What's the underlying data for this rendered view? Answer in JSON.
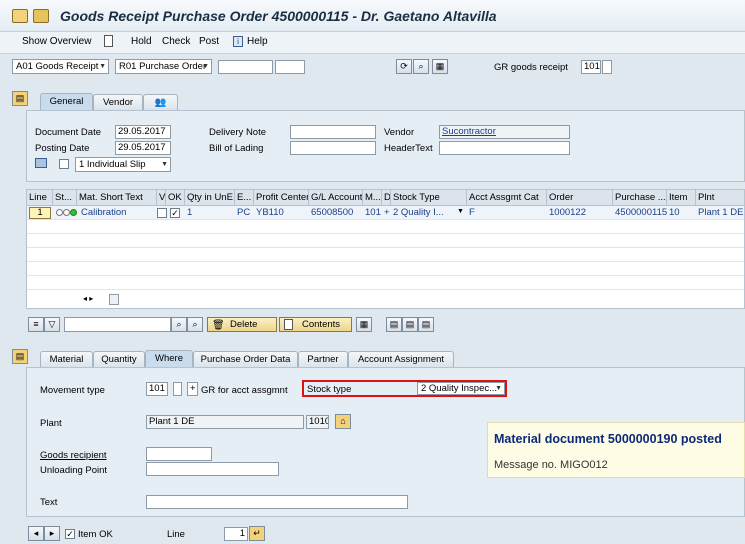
{
  "window": {
    "title": "Goods Receipt Purchase Order 4500000115 - Dr. Gaetano Altavilla"
  },
  "toolbar": {
    "show_overview": "Show Overview",
    "hold": "Hold",
    "check": "Check",
    "post": "Post",
    "help": "Help"
  },
  "header_bar": {
    "action": "A01 Goods Receipt",
    "reference": "R01 Purchase Order",
    "gr_label": "GR goods receipt",
    "movement_code": "101"
  },
  "header_tabs": [
    "General",
    "Vendor"
  ],
  "general": {
    "document_date_label": "Document Date",
    "document_date": "29.05.2017",
    "posting_date_label": "Posting Date",
    "posting_date": "29.05.2017",
    "delivery_note_label": "Delivery Note",
    "bill_of_lading_label": "Bill of Lading",
    "vendor_label": "Vendor",
    "vendor_value": "Sucontractor",
    "header_text_label": "HeaderText",
    "slip": "1 Individual Slip"
  },
  "grid": {
    "columns": [
      "Line",
      "St...",
      "Mat. Short Text",
      "V",
      "OK",
      "Qty in UnE",
      "E...",
      "Profit Center",
      "G/L Account",
      "M...",
      "D",
      "Stock Type",
      "Acct Assgmt Cat",
      "Order",
      "Purchase ...",
      "Item",
      "Plnt"
    ],
    "row": {
      "line": "1",
      "text": "Calibration",
      "qty": "1",
      "unit": "PC",
      "profit_center": "YB110",
      "gl_account": "65008500",
      "movement": "101",
      "debit": "+",
      "stock_type": "2 Quality I...",
      "acct_cat": "F",
      "order": "1000122",
      "po": "4500000115",
      "item": "10",
      "plant": "Plant 1 DE"
    }
  },
  "grid_toolbar": {
    "delete": "Delete",
    "contents": "Contents"
  },
  "item_tabs": [
    "Material",
    "Quantity",
    "Where",
    "Purchase Order Data",
    "Partner",
    "Account Assignment"
  ],
  "where": {
    "movement_type_label": "Movement type",
    "movement_type": "101",
    "sign": "+",
    "gr_acct_label": "GR for acct assgmnt",
    "stock_type_label": "Stock type",
    "stock_type": "2 Quality Inspec...",
    "plant_label": "Plant",
    "plant_name": "Plant 1 DE",
    "plant_code": "1010",
    "goods_recipient_label": "Goods recipient",
    "unloading_point_label": "Unloading Point",
    "text_label": "Text"
  },
  "message": {
    "title": "Material document 5000000190 posted",
    "number": "Message no. MIGO012"
  },
  "footer": {
    "item_ok": "Item OK",
    "line_label": "Line",
    "line_value": "1"
  },
  "colors": {
    "accent": "#1a3f8a",
    "highlight": "#e01010",
    "message_bg": "#fffce6"
  }
}
